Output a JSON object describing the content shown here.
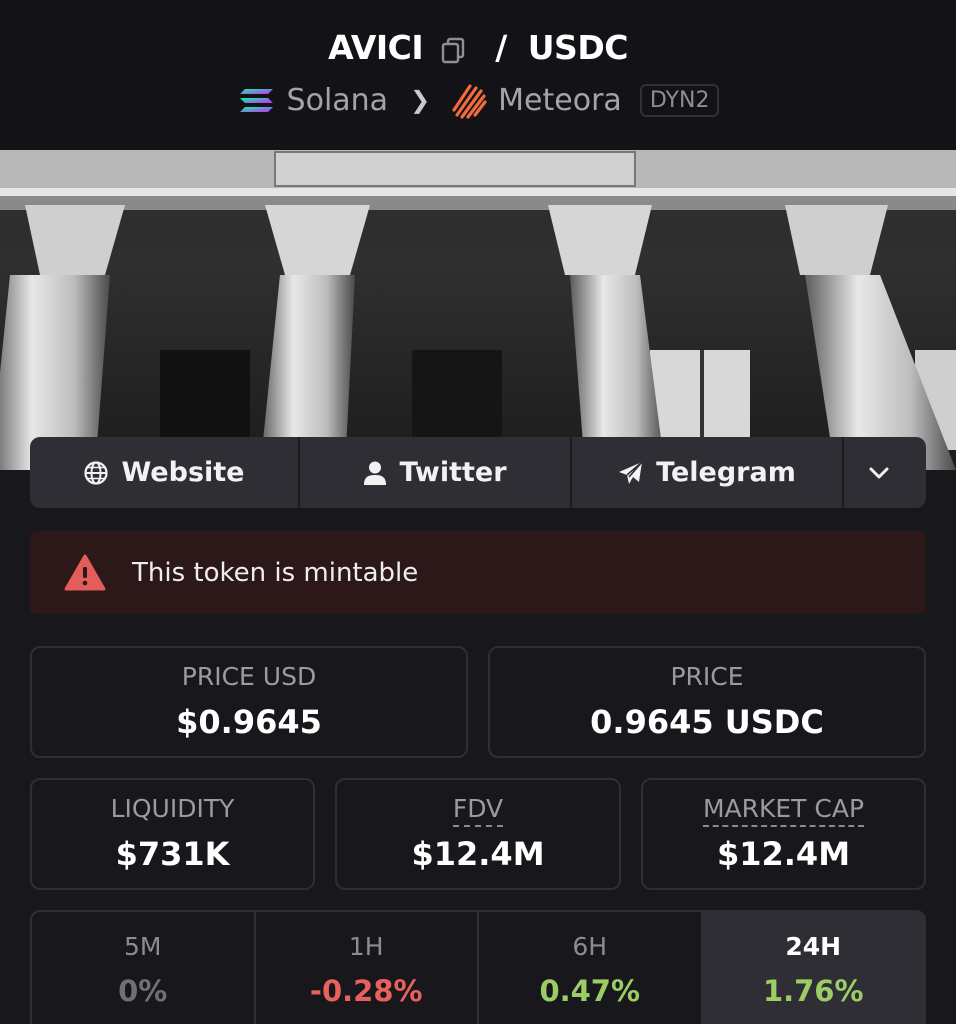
{
  "header": {
    "base_symbol": "AVICI",
    "separator": "/",
    "quote_symbol": "USDC",
    "chain": "Solana",
    "dex": "Meteora",
    "pool_type": "DYN2"
  },
  "links": [
    {
      "label": "Website",
      "icon": "globe-icon"
    },
    {
      "label": "Twitter",
      "icon": "user-icon"
    },
    {
      "label": "Telegram",
      "icon": "paper-plane-icon"
    }
  ],
  "warning": {
    "text": "This token is mintable",
    "color": "#e35d5b"
  },
  "stats": {
    "price_usd": {
      "label": "PRICE USD",
      "value": "$0.9645"
    },
    "price": {
      "label": "PRICE",
      "value": "0.9645 USDC"
    },
    "liquidity": {
      "label": "LIQUIDITY",
      "value": "$731K"
    },
    "fdv": {
      "label": "FDV",
      "value": "$12.4M"
    },
    "market_cap": {
      "label": "MARKET CAP",
      "value": "$12.4M"
    }
  },
  "changes": [
    {
      "label": "5M",
      "value": "0%",
      "color": "#6f6f77"
    },
    {
      "label": "1H",
      "value": "-0.28%",
      "color": "#e8625d"
    },
    {
      "label": "6H",
      "value": "0.47%",
      "color": "#9ccc65"
    },
    {
      "label": "24H",
      "value": "1.76%",
      "color": "#9ccc65",
      "active": true
    }
  ],
  "colors": {
    "positive": "#9ccc65",
    "negative": "#e8625d",
    "warning_bg": "#2c1818"
  }
}
